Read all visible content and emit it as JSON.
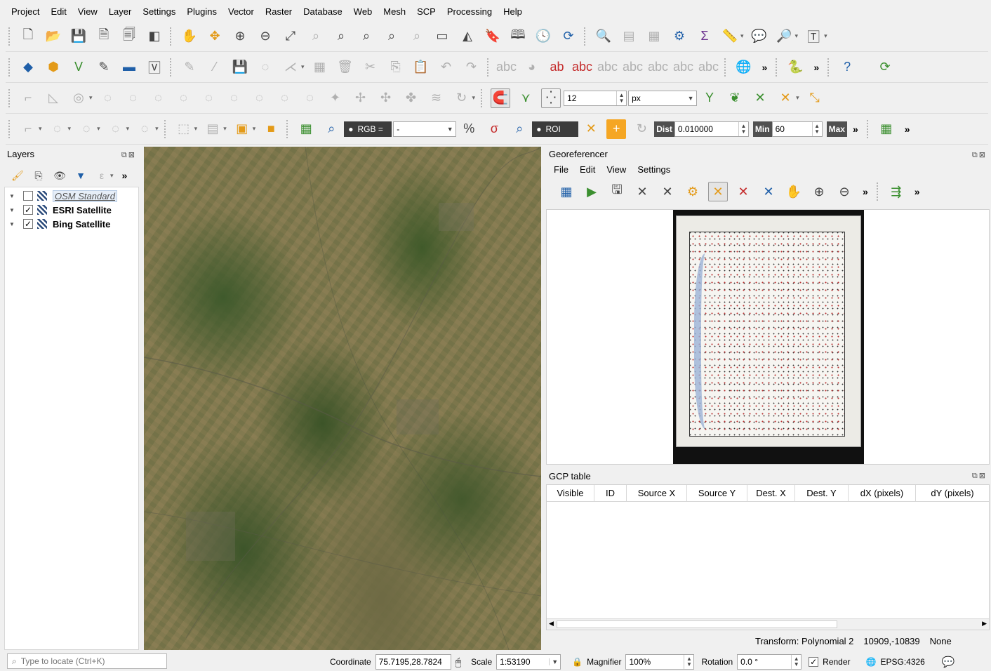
{
  "menu": [
    "Project",
    "Edit",
    "View",
    "Layer",
    "Settings",
    "Plugins",
    "Vector",
    "Raster",
    "Database",
    "Web",
    "Mesh",
    "SCP",
    "Processing",
    "Help"
  ],
  "toolbar3": {
    "snap_tolerance": "12",
    "snap_units": "px"
  },
  "toolbar4": {
    "rgb_label": "RGB =",
    "rgb_value": "-",
    "roi_label": "ROI",
    "dist_label": "Dist",
    "dist_value": "0.010000",
    "min_label": "Min",
    "min_value": "60",
    "max_label": "Max"
  },
  "layers_panel": {
    "title": "Layers",
    "items": [
      {
        "name": "OSM Standard",
        "checked": false
      },
      {
        "name": "ESRI Satellite",
        "checked": true
      },
      {
        "name": "Bing Satellite",
        "checked": true
      }
    ]
  },
  "georeferencer": {
    "title": "Georeferencer",
    "menu": [
      "File",
      "Edit",
      "View",
      "Settings"
    ]
  },
  "gcp": {
    "title": "GCP table",
    "columns": [
      "Visible",
      "ID",
      "Source X",
      "Source Y",
      "Dest. X",
      "Dest. Y",
      "dX (pixels)",
      "dY (pixels)"
    ]
  },
  "geo_status": {
    "transform": "Transform: Polynomial 2",
    "coords": "10909,-10839",
    "crs": "None"
  },
  "status": {
    "locator_placeholder": "Type to locate (Ctrl+K)",
    "coordinate_label": "Coordinate",
    "coordinate_value": "75.7195,28.7824",
    "scale_label": "Scale",
    "scale_value": "1:53190",
    "magnifier_label": "Magnifier",
    "magnifier_value": "100%",
    "rotation_label": "Rotation",
    "rotation_value": "0.0 °",
    "render_label": "Render",
    "epsg": "EPSG:4326"
  },
  "more_glyph": "»",
  "check_glyph": "✓"
}
